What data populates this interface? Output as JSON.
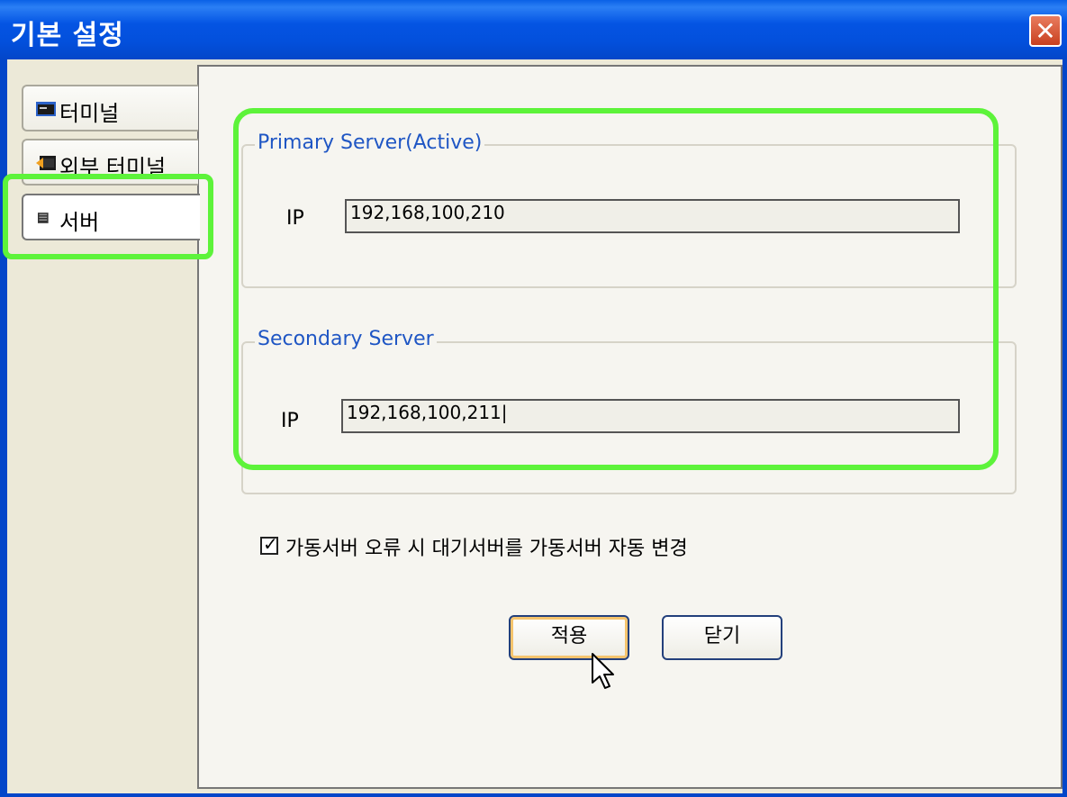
{
  "window": {
    "title": "기본 설정"
  },
  "tabs": [
    {
      "label": "터미널",
      "icon": "terminal-icon"
    },
    {
      "label": "외부 터미널",
      "icon": "external-terminal-icon"
    },
    {
      "label": "서버",
      "icon": "server-icon"
    }
  ],
  "primary": {
    "title": "Primary Server(Active)",
    "ip_label": "IP",
    "ip_value": "192,168,100,210"
  },
  "secondary": {
    "title": "Secondary Server",
    "ip_label": "IP",
    "ip_value": "192,168,100,211|"
  },
  "option": {
    "label": "가동서버 오류 시 대기서버를 가동서버 자동 변경",
    "checked": true
  },
  "buttons": {
    "apply": "적용",
    "close": "닫기"
  },
  "colors": {
    "titlebar": "#0454e3",
    "group_title": "#1f56c4",
    "highlight": "#5df33a"
  }
}
